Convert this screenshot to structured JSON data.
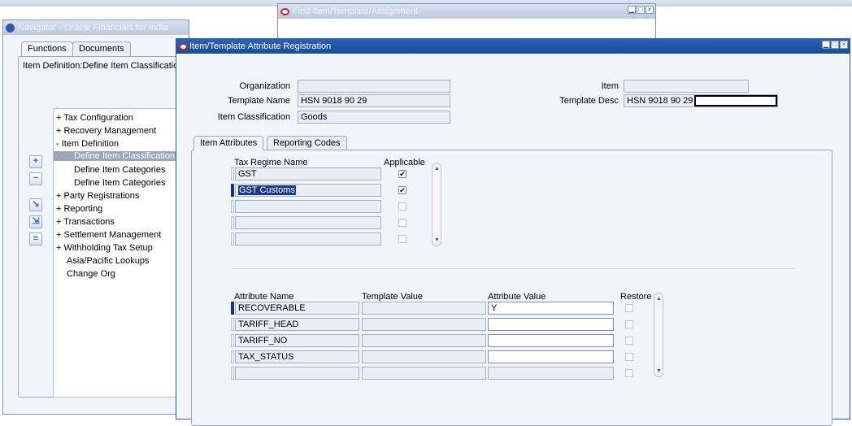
{
  "find_window": {
    "title": "Find Item/Template/Assignment"
  },
  "navigator": {
    "title": "Navigator - Oracle Financials for India",
    "tabs": [
      "Functions",
      "Documents"
    ],
    "path": "Item Definition:Define Item Classification",
    "tree": [
      "+ Tax Configuration",
      "+ Recovery Management",
      "- Item Definition",
      "Define Item Classification",
      "Define Item Categories",
      "Define Item Categories",
      "+ Party Registrations",
      "+ Reporting",
      "+ Transactions",
      "+ Settlement Management",
      "+ Withholding Tax Setup",
      "Asia/Pacific Lookups",
      "Change Org"
    ]
  },
  "main": {
    "title": "Item/Template Attribute Registration",
    "header": {
      "organization_label": "Organization",
      "organization_value": "",
      "template_name_label": "Template Name",
      "template_name_value": "HSN 9018 90 29",
      "item_classification_label": "Item Classification",
      "item_classification_value": "Goods",
      "item_label": "Item",
      "item_value": "",
      "template_desc_label": "Template Desc",
      "template_desc_value": "HSN 9018 90 29 -"
    },
    "tabs": [
      "Item Attributes",
      "Reporting Codes"
    ],
    "regime": {
      "col_name": "Tax Regime Name",
      "col_applicable": "Applicable",
      "rows": [
        {
          "name": "GST",
          "applicable": true
        },
        {
          "name": "GST Customs",
          "applicable": true
        },
        {
          "name": "",
          "applicable": false
        },
        {
          "name": "",
          "applicable": false
        },
        {
          "name": "",
          "applicable": false
        }
      ]
    },
    "attributes": {
      "col_name": "Attribute Name",
      "col_template": "Template Value",
      "col_value": "Attribute Value",
      "col_restore": "Restore",
      "rows": [
        {
          "name": "RECOVERABLE",
          "template": "",
          "value": "Y",
          "restore": false
        },
        {
          "name": "TARIFF_HEAD",
          "template": "",
          "value": "",
          "restore": false
        },
        {
          "name": "TARIFF_NO",
          "template": "",
          "value": "",
          "restore": false
        },
        {
          "name": "TAX_STATUS",
          "template": "",
          "value": "",
          "restore": false
        },
        {
          "name": "",
          "template": "",
          "value": "",
          "restore": false
        }
      ]
    }
  }
}
